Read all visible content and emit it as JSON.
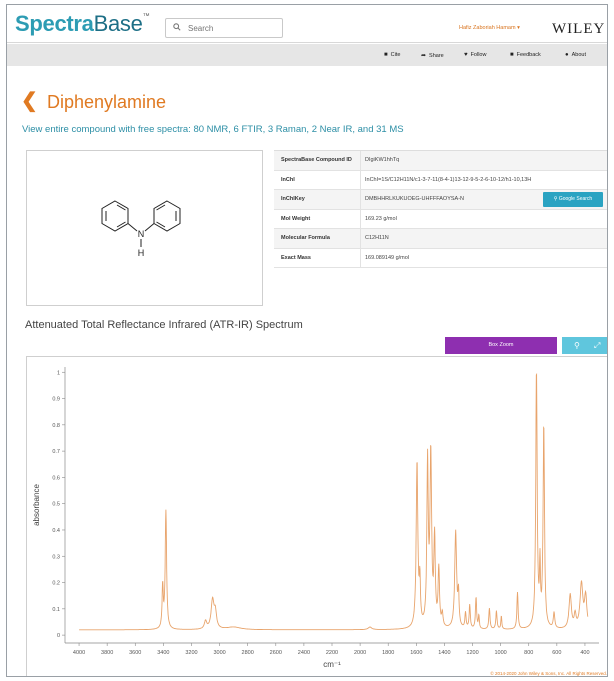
{
  "header": {
    "logo_part1": "Spectra",
    "logo_part2": "Base",
    "logo_tm": "™",
    "search_placeholder": "Search",
    "user_label": "Hafiz Zaboriah Hamam ▾",
    "publisher": "WILEY"
  },
  "actions": [
    {
      "icon": "bookmark-icon",
      "glyph": "■",
      "label": "Cite"
    },
    {
      "icon": "share-icon",
      "glyph": "➦",
      "label": "Share"
    },
    {
      "icon": "heart-icon",
      "glyph": "♥",
      "label": "Follow"
    },
    {
      "icon": "comment-icon",
      "glyph": "■",
      "label": "Feedback"
    },
    {
      "icon": "question-icon",
      "glyph": "●",
      "label": "About"
    }
  ],
  "compound": {
    "back_glyph": "❮",
    "name": "Diphenylamine",
    "spectra_summary": "View entire compound with free spectra: 80 NMR, 6 FTIR, 3 Raman, 2 Near IR, and 31 MS",
    "structure_labels": {
      "n": "N",
      "h": "H"
    }
  },
  "properties": [
    {
      "key": "SpectraBase Compound ID",
      "value": "DIgiKW1hhTq"
    },
    {
      "key": "InChI",
      "value": "InChI=1S/C12H11N/c1-3-7-11(8-4-1)13-12-9-5-2-6-10-12/h1-10,13H"
    },
    {
      "key": "InChIKey",
      "value": "DMBHHRLKUKUOEG-UHFFFAOYSA-N"
    },
    {
      "key": "Mol Weight",
      "value": "169.23 g/mol"
    },
    {
      "key": "Molecular Formula",
      "value": "C12H11N"
    },
    {
      "key": "Exact Mass",
      "value": "169.089149 g/mol"
    }
  ],
  "google_search_label": "Google Search",
  "spectrum": {
    "title": "Attenuated Total Reflectance Infrared (ATR-IR) Spectrum",
    "box_zoom_label": "Box Zoom",
    "copyright": "© 2014-2020 John Wiley & Sons, Inc. All Rights Reserved."
  },
  "colors": {
    "accent": "#e07a22",
    "teal": "#2d8fa6",
    "purple": "#8e2fb0",
    "line": "#e8a46c"
  },
  "chart_data": {
    "type": "line",
    "xlabel": "cm⁻¹",
    "ylabel": "absorbance",
    "xlim": [
      4100,
      300
    ],
    "ylim": [
      -0.03,
      1.02
    ],
    "x_ticks": [
      4000,
      3800,
      3600,
      3400,
      3200,
      3000,
      2800,
      2600,
      2400,
      2200,
      2000,
      1800,
      1600,
      1400,
      1200,
      1000,
      800,
      600,
      400
    ],
    "y_ticks": [
      0,
      0.1,
      0.2,
      0.3,
      0.4,
      0.5,
      0.6,
      0.7,
      0.8,
      0.9,
      1
    ],
    "y_tick_labels": [
      "0",
      "0.1",
      "0.2",
      "0.3",
      "0.4",
      "0.5",
      "0.6",
      "0.7",
      "0.8",
      "0.9",
      "1"
    ],
    "baseline": 0.02,
    "peaks": [
      [
        3405,
        0.16,
        5
      ],
      [
        3382,
        0.45,
        6
      ],
      [
        3050,
        0.11,
        12
      ],
      [
        3030,
        0.06,
        10
      ],
      [
        3100,
        0.03,
        10
      ],
      [
        2900,
        0.01,
        60
      ],
      [
        1930,
        0.01,
        15
      ],
      [
        1595,
        0.63,
        7
      ],
      [
        1575,
        0.16,
        5
      ],
      [
        1520,
        0.62,
        6
      ],
      [
        1497,
        0.65,
        7
      ],
      [
        1470,
        0.33,
        6
      ],
      [
        1440,
        0.22,
        6
      ],
      [
        1415,
        0.05,
        6
      ],
      [
        1320,
        0.37,
        8
      ],
      [
        1300,
        0.12,
        5
      ],
      [
        1250,
        0.06,
        5
      ],
      [
        1220,
        0.09,
        5
      ],
      [
        1175,
        0.12,
        5
      ],
      [
        1155,
        0.05,
        4
      ],
      [
        1080,
        0.08,
        5
      ],
      [
        1030,
        0.07,
        5
      ],
      [
        995,
        0.05,
        4
      ],
      [
        880,
        0.14,
        5
      ],
      [
        745,
        0.98,
        6
      ],
      [
        720,
        0.22,
        4
      ],
      [
        693,
        0.77,
        6
      ],
      [
        620,
        0.06,
        6
      ],
      [
        505,
        0.13,
        10
      ],
      [
        470,
        0.05,
        8
      ],
      [
        425,
        0.17,
        12
      ],
      [
        395,
        0.12,
        10
      ]
    ]
  }
}
